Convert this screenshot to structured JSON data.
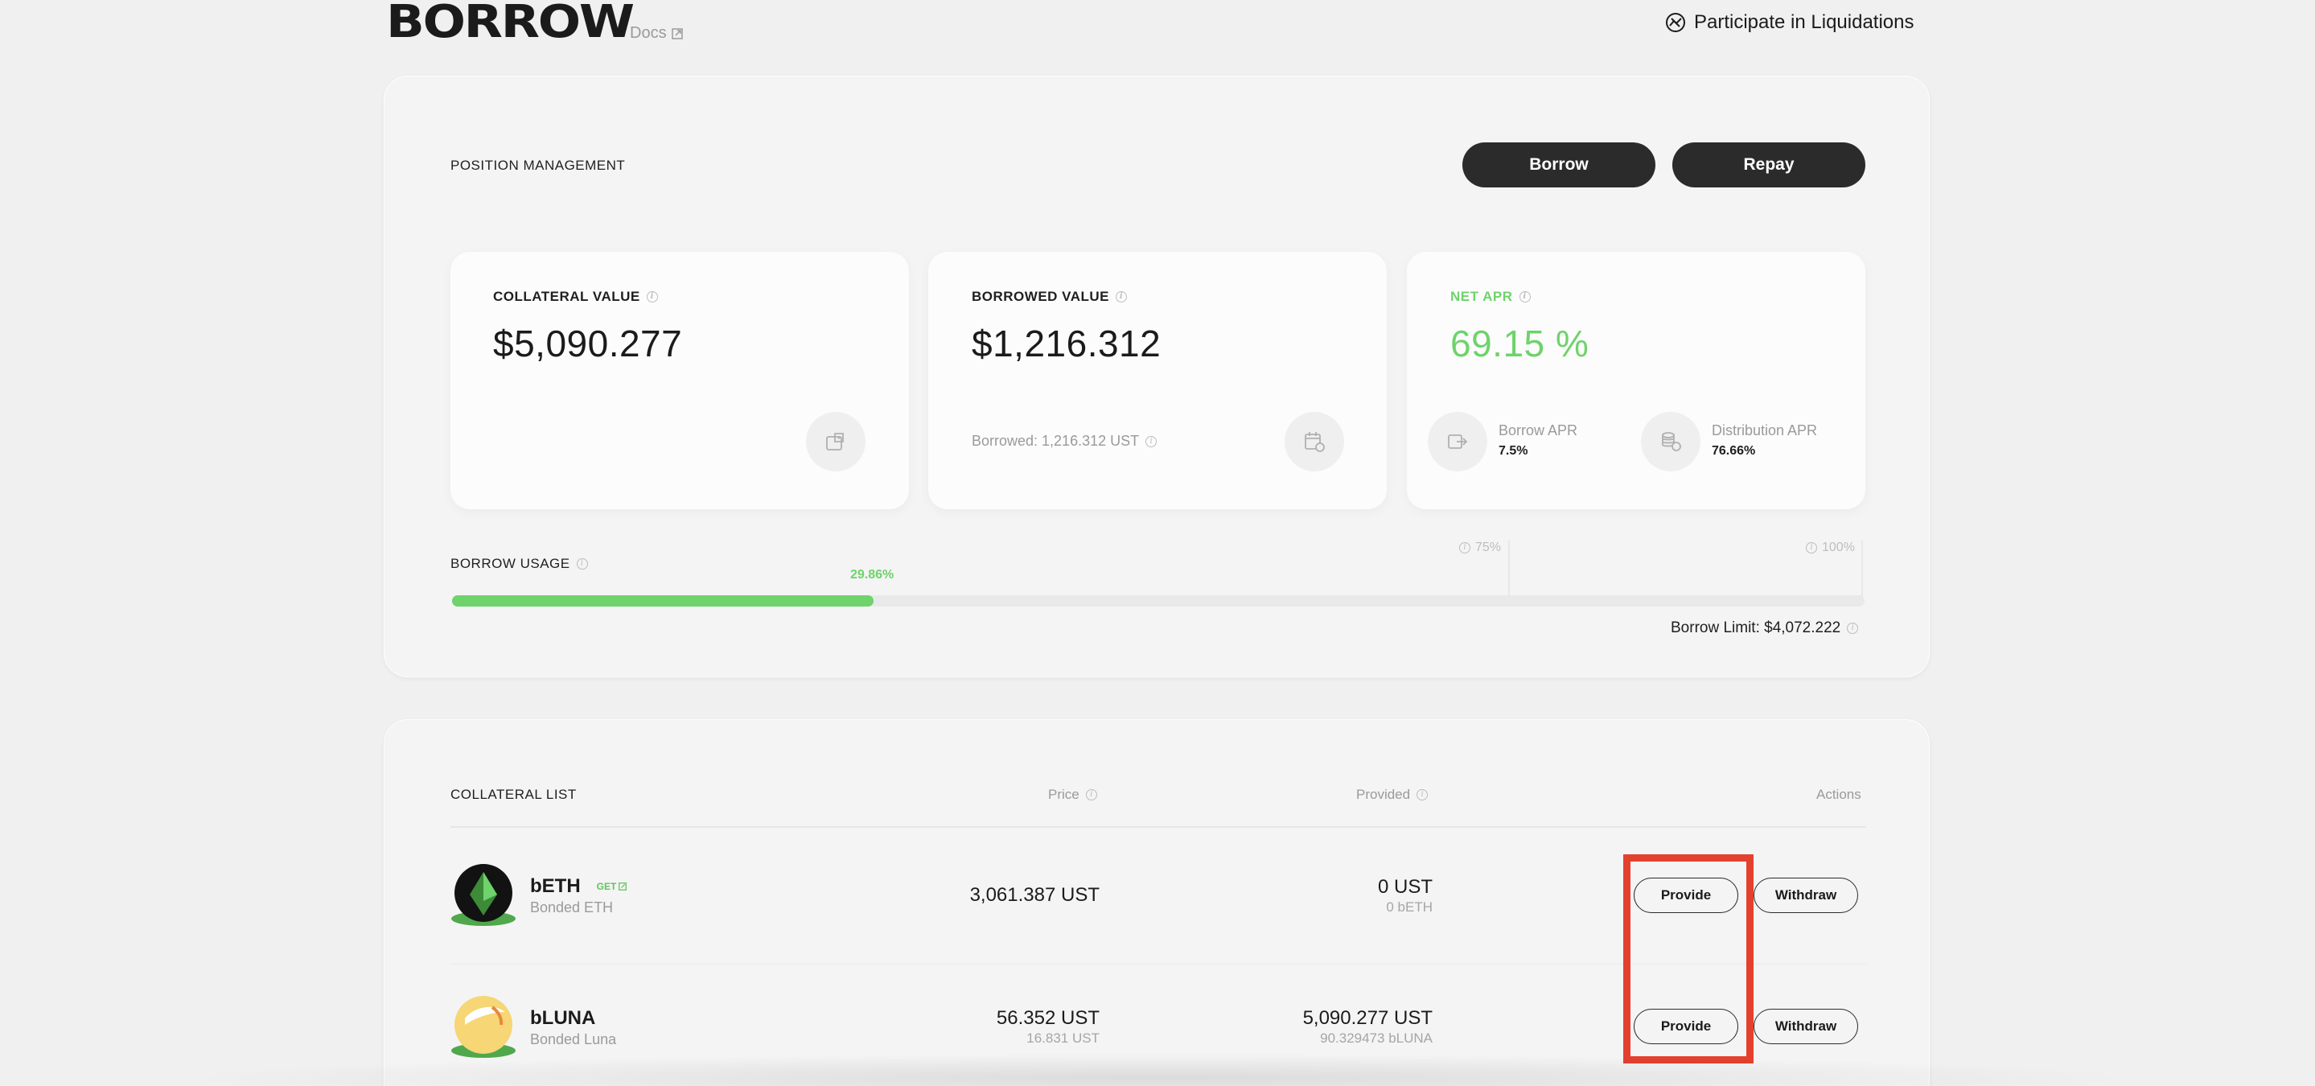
{
  "header": {
    "title": "BORROW",
    "docs_label": "Docs",
    "liquidations_label": "Participate in Liquidations"
  },
  "position": {
    "section_label": "POSITION MANAGEMENT",
    "borrow_label": "Borrow",
    "repay_label": "Repay",
    "collateral": {
      "title": "COLLATERAL VALUE",
      "value": "$5,090.277"
    },
    "borrowed": {
      "title": "BORROWED VALUE",
      "value": "$1,216.312",
      "sub": "Borrowed: 1,216.312 UST"
    },
    "net_apr": {
      "title": "NET APR",
      "value": "69.15 %",
      "borrow_apr_label": "Borrow APR",
      "borrow_apr_value": "7.5%",
      "distribution_apr_label": "Distribution APR",
      "distribution_apr_value": "76.66%"
    },
    "usage": {
      "label": "BORROW USAGE",
      "percent_label": "29.86%",
      "percent": 29.86,
      "tick_75": "75%",
      "tick_100": "100%",
      "limit_text": "Borrow Limit: $4,072.222"
    }
  },
  "collateral_list": {
    "title": "COLLATERAL LIST",
    "col_price": "Price",
    "col_provided": "Provided",
    "col_actions": "Actions",
    "provide_label": "Provide",
    "withdraw_label": "Withdraw",
    "rows": [
      {
        "name": "bETH",
        "tag": "GET",
        "sub": "Bonded ETH",
        "price": "3,061.387 UST",
        "provided": "0 UST",
        "provided_sub": "0 bETH"
      },
      {
        "name": "bLUNA",
        "sub": "Bonded Luna",
        "price": "56.352 UST",
        "price_sub": "16.831 UST",
        "provided": "5,090.277 UST",
        "provided_sub": "90.329473 bLUNA"
      }
    ]
  },
  "colors": {
    "accent_green": "#6ed36b",
    "dark_button": "#2b2b2b",
    "highlight_red": "#e4402e"
  }
}
